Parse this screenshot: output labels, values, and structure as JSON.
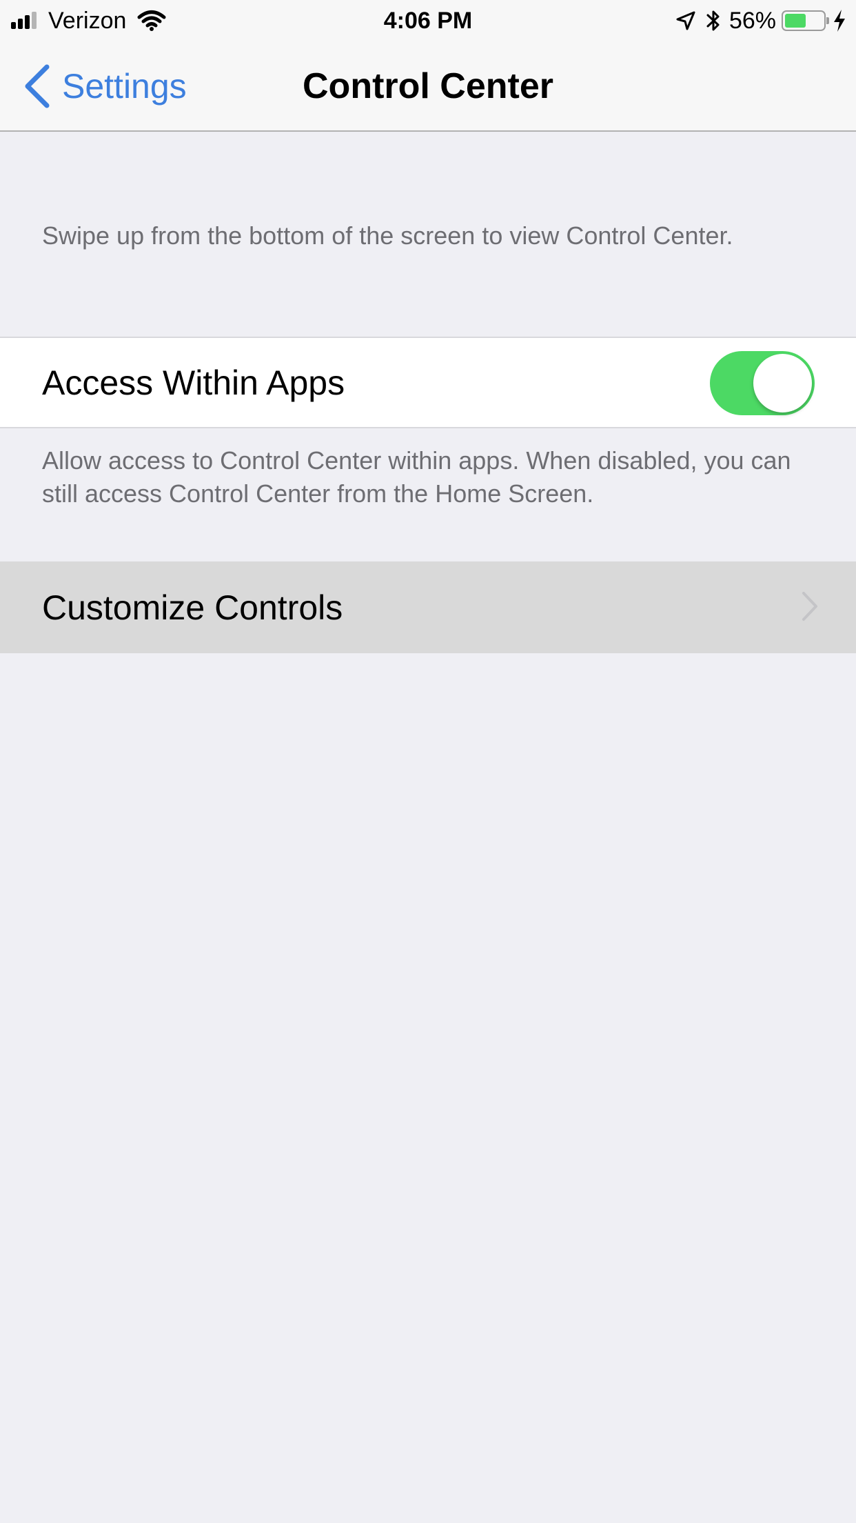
{
  "status_bar": {
    "carrier": "Verizon",
    "time": "4:06 PM",
    "battery_percent": "56%",
    "battery_level": 0.56,
    "signal_bars": 3,
    "signal_bars_total": 4,
    "icons": [
      "signal-icon",
      "wifi-icon",
      "location-arrow-icon",
      "bluetooth-icon",
      "battery-icon",
      "charging-bolt-icon"
    ]
  },
  "nav": {
    "back_label": "Settings",
    "title": "Control Center"
  },
  "intro_text": "Swipe up from the bottom of the screen to view Control Center.",
  "access_within_apps": {
    "label": "Access Within Apps",
    "enabled": true,
    "footer": "Allow access to Control Center within apps. When disabled, you can still access Control Center from the Home Screen."
  },
  "customize": {
    "label": "Customize Controls"
  },
  "colors": {
    "accent": "#3d7fde",
    "toggle_on": "#4cd964",
    "background": "#efeff4",
    "secondary_text": "#6d6d72"
  }
}
